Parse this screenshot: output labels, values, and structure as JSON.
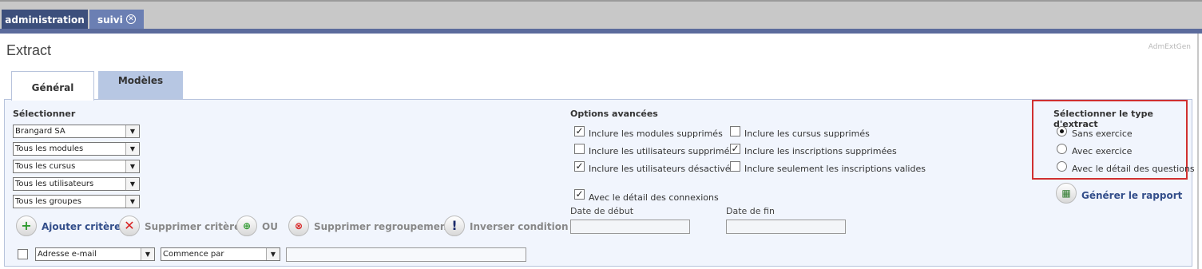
{
  "tabs_top": {
    "admin": "administration",
    "suivi": "suivi"
  },
  "page": {
    "title": "Extract",
    "code": "AdmExtGen"
  },
  "subtabs": {
    "general": "Général",
    "modeles": "Modèles"
  },
  "selectionner": {
    "label": "Sélectionner",
    "dropdowns": [
      "Brangard SA",
      "Tous les modules",
      "Tous les cursus",
      "Tous les utilisateurs",
      "Tous les groupes"
    ]
  },
  "actions": {
    "ajouter": "Ajouter critère",
    "supprimer": "Supprimer critère",
    "ou": "OU",
    "supprimer_regroupement": "Supprimer regroupement",
    "inverser": "Inverser condition"
  },
  "criteria": {
    "field": "Adresse e-mail",
    "operator": "Commence par",
    "value": ""
  },
  "options": {
    "label": "Options avancées",
    "items": [
      {
        "label": "Inclure les modules supprimés",
        "checked": true
      },
      {
        "label": "Inclure les utilisateurs supprimés",
        "checked": false
      },
      {
        "label": "Inclure les utilisateurs désactivés",
        "checked": true
      },
      {
        "label": "Inclure les cursus supprimés",
        "checked": false
      },
      {
        "label": "Inclure les inscriptions supprimées",
        "checked": true
      },
      {
        "label": "Inclure seulement les inscriptions valides",
        "checked": false
      }
    ],
    "detail_connexions": {
      "label": "Avec le détail des connexions",
      "checked": true
    },
    "date_debut": "Date de début",
    "date_fin": "Date de fin"
  },
  "extract_type": {
    "label": "Sélectionner le type d'extract",
    "options": [
      {
        "label": "Sans exercice",
        "selected": true
      },
      {
        "label": "Avec exercice",
        "selected": false
      },
      {
        "label": "Avec le détail des questions",
        "selected": false
      }
    ]
  },
  "generate": "Générer le rapport",
  "colors": {
    "accent": "#5b6b9c",
    "panel": "#f1f5fd",
    "link": "#334e8a",
    "highlight": "#d03030"
  }
}
